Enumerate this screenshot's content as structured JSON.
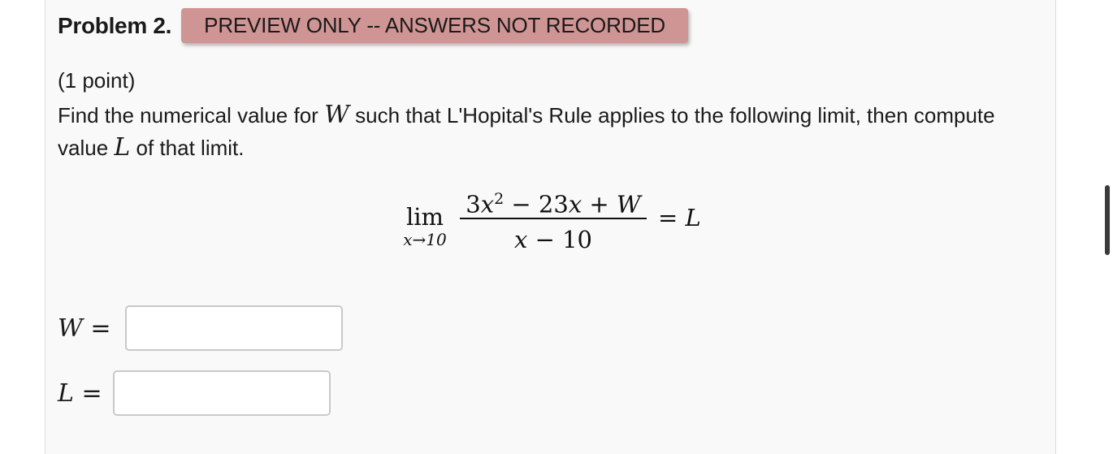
{
  "problem": {
    "title": "Problem 2.",
    "preview_badge": "PREVIEW ONLY -- ANSWERS NOT RECORDED",
    "points": "(1 point)",
    "statement": {
      "part1": "Find the numerical value for",
      "var_w": "W",
      "part2": "such that L'Hopital's Rule applies to the following limit, then compute value",
      "var_l": "L",
      "part3": "of that limit."
    }
  },
  "limit_expression": {
    "lim": "lim",
    "subscript": "x→10",
    "numerator": {
      "coef": "3",
      "var": "x",
      "exp": "2",
      "op1": " − 23",
      "var2": "x",
      "op2": " + ",
      "const": "W"
    },
    "denominator": {
      "var": "x",
      "rest": " − 10"
    },
    "equals": "= ",
    "result": "L"
  },
  "answers": [
    {
      "var": "W",
      "eq": " =",
      "value": "",
      "placeholder": ""
    },
    {
      "var": "L",
      "eq": " =",
      "value": "",
      "placeholder": ""
    }
  ]
}
